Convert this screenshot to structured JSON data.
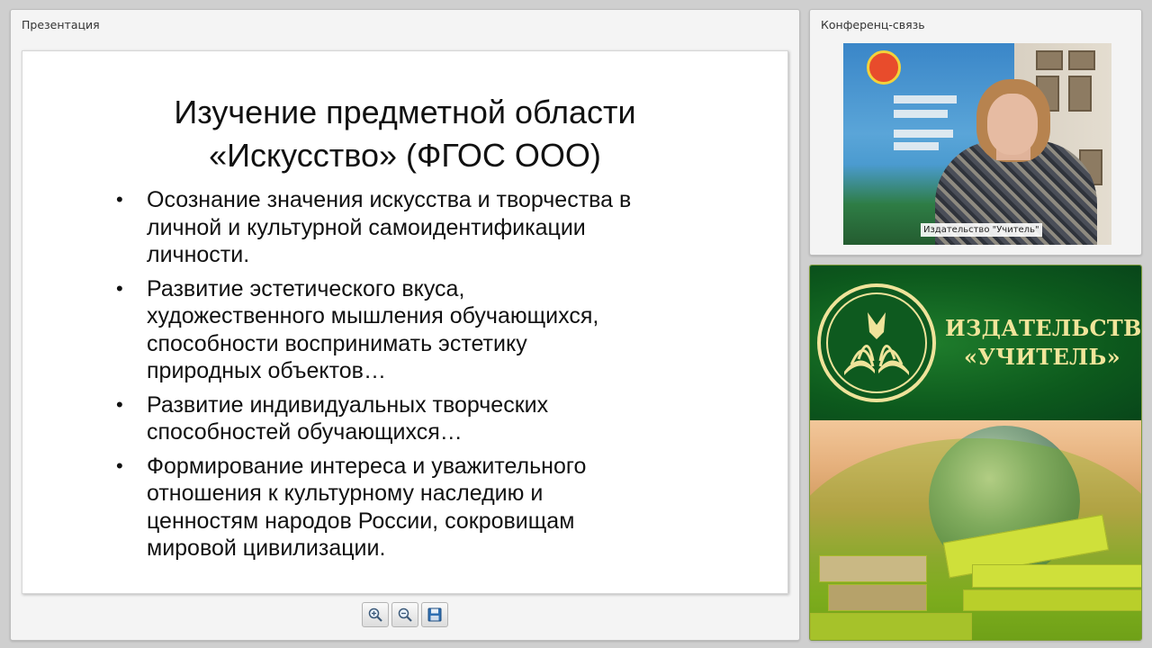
{
  "presentation": {
    "title": "Презентация",
    "slide": {
      "title_lines": [
        "Изучение предметной области",
        "«Искусство» (ФГОС ООО)"
      ],
      "bullets": [
        [
          "Осознание значения искусства и творчества в",
          "личной и культурной самоидентификации",
          "личности."
        ],
        [
          "Развитие эстетического вкуса,",
          "художественного мышления обучающихся,",
          "способности воспринимать эстетику",
          "природных объектов…"
        ],
        [
          "Развитие индивидуальных творческих",
          "способностей обучающихся…"
        ],
        [
          "Формирование интереса и уважительного",
          "отношения к культурному наследию и",
          "ценностям народов России, сокровищам",
          "мировой цивилизации."
        ]
      ]
    },
    "toolbar": {
      "zoom_in_icon": "zoom-in-icon",
      "zoom_out_icon": "zoom-out-icon",
      "save_icon": "floppy-disk-icon"
    }
  },
  "conference": {
    "title": "Конференц-связь",
    "video_caption": "Издательство \"Учитель\""
  },
  "publisher": {
    "name_lines": [
      "ИЗДАТЕЛЬСТВО",
      "«УЧИТЕЛЬ»"
    ],
    "colors": {
      "banner_green": "#0d5a1d",
      "text_gold": "#f1e59a"
    }
  }
}
